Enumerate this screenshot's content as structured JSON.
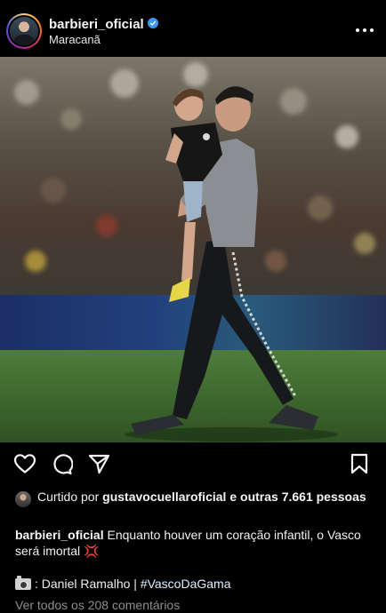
{
  "post": {
    "username": "barbieri_oficial",
    "location": "Maracanã",
    "liked_by_prefix": "Curtido por",
    "liked_by_user": "gustavocuellaroficial",
    "liked_by_connector": "e",
    "liked_by_others": "outras 7.661 pessoas",
    "caption_user": "barbieri_oficial",
    "caption_text": "Enquanto houver um coração infantil, o Vasco será imortal",
    "caption_emoji": "💢",
    "credit_text": ": Daniel Ramalho |",
    "hashtag": "#VascoDaGama",
    "comments_link": "Ver todos os 208 comentários"
  },
  "icons": {
    "verified": "verified-badge-icon",
    "more": "more-options-icon",
    "like": "heart-icon",
    "comment": "comment-icon",
    "share": "send-icon",
    "save": "bookmark-icon",
    "camera": "camera-emoji-icon"
  },
  "colors": {
    "background": "#000000",
    "verified": "#3897f0",
    "text": "#f5f5f5",
    "muted": "#8e8e8e",
    "pitch": "#3f6b2f"
  }
}
